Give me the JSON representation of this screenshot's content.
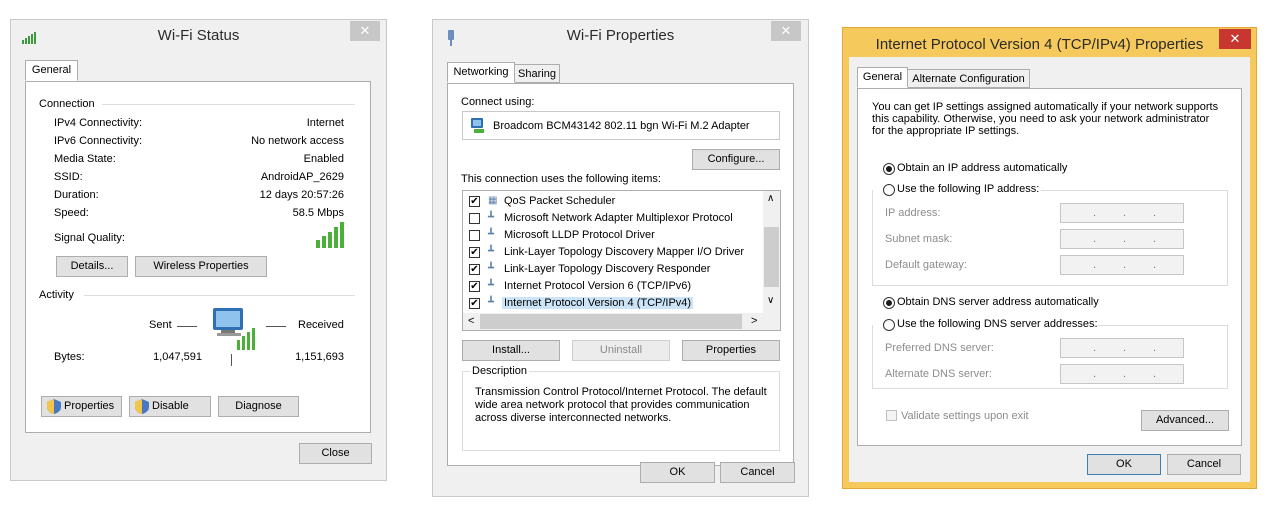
{
  "wifi_status": {
    "title": "Wi-Fi Status",
    "close_x": "✕",
    "tab": "General",
    "connection_header": "Connection",
    "rows": [
      {
        "label": "IPv4 Connectivity:",
        "value": "Internet"
      },
      {
        "label": "IPv6 Connectivity:",
        "value": "No network access"
      },
      {
        "label": "Media State:",
        "value": "Enabled"
      },
      {
        "label": "SSID:",
        "value": "AndroidAP_2629"
      },
      {
        "label": "Duration:",
        "value": "12 days 20:57:26"
      },
      {
        "label": "Speed:",
        "value": "58.5 Mbps"
      }
    ],
    "signal_label": "Signal Quality:",
    "signal_bars_lit": 5,
    "details_button": "Details...",
    "wireless_properties_button": "Wireless Properties",
    "activity_header": "Activity",
    "sent_label": "Sent",
    "received_label": "Received",
    "bytes_label": "Bytes:",
    "bytes_sent": "1,047,591",
    "bytes_received": "1,151,693",
    "properties_button": "Properties",
    "disable_button": "Disable",
    "diagnose_button": "Diagnose",
    "close_button": "Close"
  },
  "wifi_properties": {
    "title": "Wi-Fi Properties",
    "close_x": "✕",
    "tabs": [
      "Networking",
      "Sharing"
    ],
    "connect_using_label": "Connect using:",
    "adapter_name": "Broadcom BCM43142 802.11 bgn Wi-Fi M.2 Adapter",
    "configure_button": "Configure...",
    "items_label": "This connection uses the following items:",
    "items": [
      {
        "label": "QoS Packet Scheduler",
        "checked": true,
        "check_glyph": "✔"
      },
      {
        "label": "Microsoft Network Adapter Multiplexor Protocol",
        "checked": false,
        "check_glyph": ""
      },
      {
        "label": "Microsoft LLDP Protocol Driver",
        "checked": false,
        "check_glyph": ""
      },
      {
        "label": "Link-Layer Topology Discovery Mapper I/O Driver",
        "checked": true,
        "check_glyph": "✔"
      },
      {
        "label": "Link-Layer Topology Discovery Responder",
        "checked": true,
        "check_glyph": "✔"
      },
      {
        "label": "Internet Protocol Version 6 (TCP/IPv6)",
        "checked": true,
        "check_glyph": "✔"
      },
      {
        "label": "Internet Protocol Version 4 (TCP/IPv4)",
        "checked": true,
        "check_glyph": "✔",
        "selected": true
      }
    ],
    "install_button": "Install...",
    "uninstall_button": "Uninstall",
    "properties_button": "Properties",
    "description_header": "Description",
    "description_text": "Transmission Control Protocol/Internet Protocol. The default wide area network protocol that provides communication across diverse interconnected networks.",
    "ok_button": "OK",
    "cancel_button": "Cancel"
  },
  "ipv4_properties": {
    "title": "Internet Protocol Version 4 (TCP/IPv4) Properties",
    "close_x": "✕",
    "tabs": [
      "General",
      "Alternate Configuration"
    ],
    "intro_text": "You can get IP settings assigned automatically if your network supports this capability. Otherwise, you need to ask your network administrator for the appropriate IP settings.",
    "obtain_ip_auto": "Obtain an IP address automatically",
    "use_following_ip": "Use the following IP address:",
    "ip_address_label": "IP address:",
    "subnet_mask_label": "Subnet mask:",
    "default_gateway_label": "Default gateway:",
    "obtain_dns_auto": "Obtain DNS server address automatically",
    "use_following_dns": "Use the following DNS server addresses:",
    "preferred_dns_label": "Preferred DNS server:",
    "alternate_dns_label": "Alternate DNS server:",
    "ip_dot": ".",
    "validate_label": "Validate settings upon exit",
    "advanced_button": "Advanced...",
    "ok_button": "OK",
    "cancel_button": "Cancel"
  },
  "scroll_glyphs": {
    "up": "∧",
    "down": "∨",
    "left": "<",
    "right": ">"
  },
  "colors": {
    "accent_orange": "#f5c95b",
    "close_red": "#c7372f",
    "signal_green": "#4caf3a",
    "selection_blue": "#cce4f7"
  }
}
